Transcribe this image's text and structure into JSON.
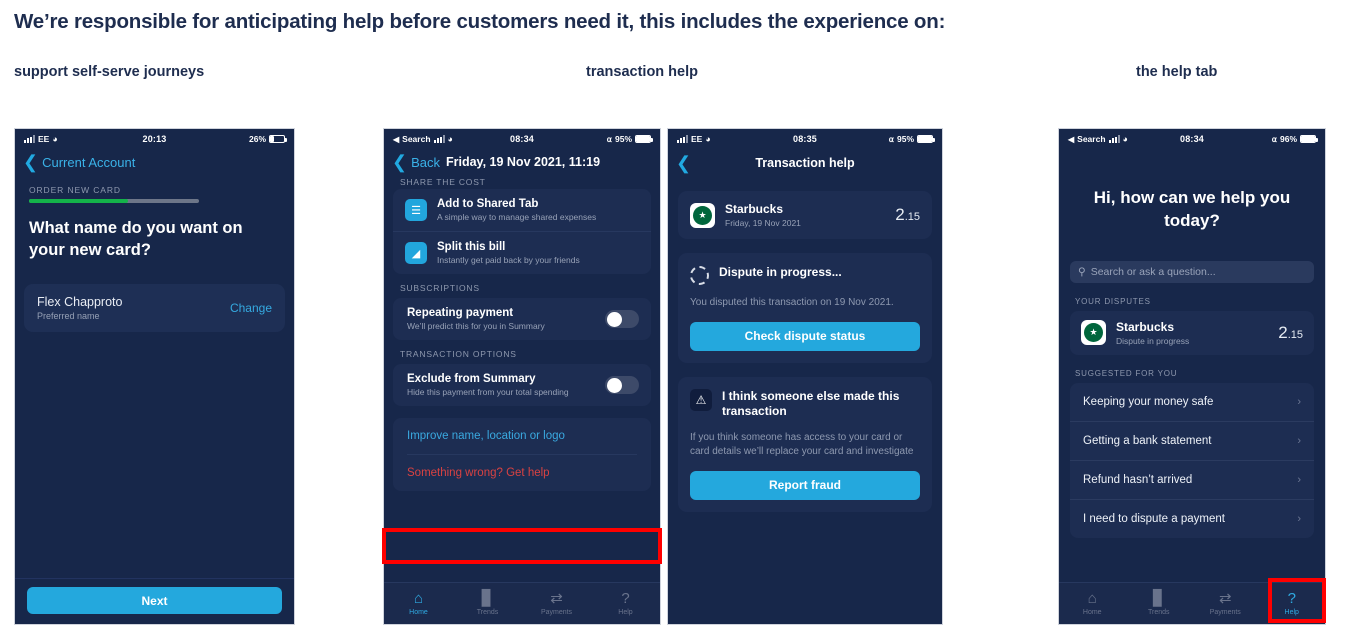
{
  "heading": "We’re responsible for anticipating help before customers need it, this includes the experience on:",
  "captions": [
    "support self-serve journeys",
    "transaction help",
    "the help tab"
  ],
  "colors": {
    "heading": "#1e2d4f",
    "screen_bg": "#17274a",
    "card_bg": "#1d2d52",
    "accent_blue": "#24a8dd",
    "link_red": "#e54b4b",
    "progress_green": "#14b34a",
    "highlight_red": "#ff0000"
  },
  "phone1": {
    "status": {
      "carrier": "EE",
      "time": "20:13",
      "battery": "26%"
    },
    "nav": {
      "back_label": "Current Account"
    },
    "section_label": "ORDER NEW CARD",
    "progress_percent": 58,
    "question": "What name do you want on your new card?",
    "name_card": {
      "name": "Flex Chapproto",
      "sublabel": "Preferred name",
      "action": "Change"
    },
    "primary_button": "Next"
  },
  "phone2": {
    "status": {
      "carrier": "Search",
      "time": "08:34",
      "battery": "95%"
    },
    "nav": {
      "back_label": "Back",
      "title": "Friday, 19 Nov 2021, 11:19"
    },
    "clipped_label": "SHARE THE COST",
    "share_rows": [
      {
        "icon": "list-icon",
        "title": "Add to Shared Tab",
        "sub": "A simple way to manage shared expenses"
      },
      {
        "icon": "split-bill-icon",
        "title": "Split this bill",
        "sub": "Instantly get paid back by your friends"
      }
    ],
    "subscriptions_label": "SUBSCRIPTIONS",
    "subscription_row": {
      "title": "Repeating payment",
      "sub": "We’ll predict this for you in Summary",
      "toggle_on": false
    },
    "options_label": "TRANSACTION OPTIONS",
    "option_row": {
      "title": "Exclude from Summary",
      "sub": "Hide this payment from your total spending",
      "toggle_on": false
    },
    "links": [
      {
        "label": "Improve name, location or logo",
        "style": "blue"
      },
      {
        "label": "Something wrong? Get help",
        "style": "red",
        "highlighted": true
      }
    ],
    "tabs": [
      {
        "icon": "home-icon",
        "label": "Home",
        "active": true
      },
      {
        "icon": "trends-icon",
        "label": "Trends",
        "active": false
      },
      {
        "icon": "payments-icon",
        "label": "Payments",
        "active": false
      },
      {
        "icon": "help-icon",
        "label": "Help",
        "active": false
      }
    ]
  },
  "phone3": {
    "status": {
      "carrier": "EE",
      "time": "08:35",
      "battery": "95%"
    },
    "nav": {
      "title": "Transaction help"
    },
    "transaction": {
      "merchant": "Starbucks",
      "date": "Friday, 19 Nov 2021",
      "amount_major": "2",
      "amount_minor": ".15"
    },
    "dispute_block": {
      "title": "Dispute in progress...",
      "body": "You disputed this transaction on 19 Nov 2021.",
      "button": "Check dispute status"
    },
    "fraud_block": {
      "title": "I think someone else made this transaction",
      "body": "If you think someone has access to your card or card details we’ll replace your card and investigate",
      "button": "Report fraud"
    }
  },
  "phone4": {
    "status": {
      "carrier": "Search",
      "time": "08:34",
      "battery": "96%"
    },
    "hero": "Hi, how can we help you today?",
    "search_placeholder": "Search or ask a question...",
    "disputes_label": "YOUR DISPUTES",
    "dispute": {
      "merchant": "Starbucks",
      "sub": "Dispute in progress",
      "amount_major": "2",
      "amount_minor": ".15"
    },
    "suggested_label": "SUGGESTED FOR YOU",
    "suggested": [
      "Keeping your money safe",
      "Getting a bank statement",
      "Refund hasn’t arrived",
      "I need to dispute a payment"
    ],
    "tabs": [
      {
        "icon": "home-icon",
        "label": "Home",
        "active": false
      },
      {
        "icon": "trends-icon",
        "label": "Trends",
        "active": false
      },
      {
        "icon": "payments-icon",
        "label": "Payments",
        "active": false
      },
      {
        "icon": "help-icon",
        "label": "Help",
        "active": true,
        "highlighted": true
      }
    ]
  }
}
